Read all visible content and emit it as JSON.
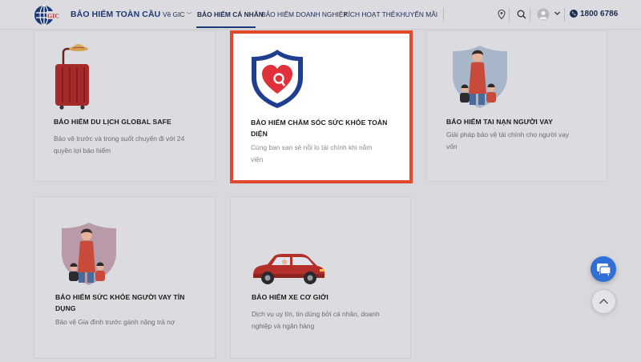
{
  "header": {
    "brand": "BẢO HIỂM TOÀN CẦU",
    "logo_text": "GIC",
    "nav": [
      {
        "label": "Về GIC"
      },
      {
        "label": "BẢO HIỂM CÁ NHÂN"
      },
      {
        "label": "BẢO HIỂM DOANH NGHIỆP"
      },
      {
        "label": "KÍCH HOẠT THẺ"
      },
      {
        "label": "KHUYẾN MÃI"
      }
    ],
    "phone": "1800 6786",
    "icons": [
      "location-pin-icon",
      "search-icon",
      "user-avatar-icon",
      "chevron-down-icon",
      "phone-icon"
    ]
  },
  "cards": [
    {
      "title": "BẢO HIỂM DU LỊCH GLOBAL SAFE",
      "desc_lines": [
        "Bảo vệ trước và trong suốt chuyến đi với 24",
        "quyền lợi bảo hiểm"
      ]
    },
    {
      "title_lines": [
        "BẢO HIỂM CHĂM SÓC SỨC KHỎE TOÀN",
        "DIỆN"
      ],
      "desc_lines": [
        "Cùng bạn san sẻ nỗi lo tài chính khi nằm",
        "viện"
      ]
    },
    {
      "title": "BẢO HIỂM TAI NẠN NGƯỜI VAY",
      "desc_lines": [
        "Giải pháp bảo vệ tài chính cho người vay",
        "vốn"
      ]
    },
    {
      "title_lines": [
        "BẢO HIỂM SỨC KHỎE NGƯỜI VAY TÍN",
        "DỤNG"
      ],
      "desc_lines": [
        "Bảo vệ Gia đình trước gánh nặng trả nợ"
      ]
    },
    {
      "title": "BẢO HIỂM XE CƠ GIỚI",
      "desc_lines": [
        "Dịch vụ uy tín, tin dùng bởi cá nhân, doanh",
        "nghiệp và ngân hàng"
      ]
    }
  ],
  "colors": {
    "brand_blue": "#1d3a78",
    "highlight_border": "#e2482c",
    "chat_button": "#2f6fd6",
    "page_bg": "#d9d9dd"
  }
}
